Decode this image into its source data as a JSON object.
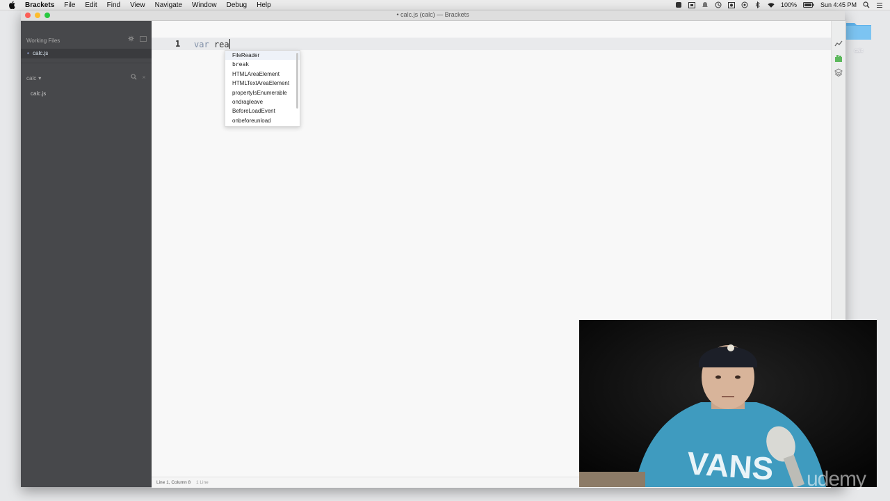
{
  "menubar": {
    "app_name": "Brackets",
    "items": [
      "File",
      "Edit",
      "Find",
      "View",
      "Navigate",
      "Window",
      "Debug",
      "Help"
    ],
    "battery": "100%",
    "clock": "Sun 4:45 PM"
  },
  "window": {
    "title": "• calc.js (calc) — Brackets"
  },
  "sidebar": {
    "working_files_label": "Working Files",
    "working_file": "calc.js",
    "project_name": "calc",
    "project_caret": "▾",
    "files": [
      "calc.js"
    ]
  },
  "editor": {
    "line_number": "1",
    "code_keyword": "var",
    "code_rest": " rea"
  },
  "code_hints": {
    "selected_index": 0,
    "items": [
      "FileReader",
      "break",
      "HTMLAreaElement",
      "HTMLTextAreaElement",
      "propertyIsEnumerable",
      "ondragleave",
      "BeforeLoadEvent",
      "onbeforeunload"
    ]
  },
  "statusbar": {
    "position": "Line 1, Column 8",
    "lines": "1 Line"
  },
  "desktop": {
    "folder_label": "calc"
  },
  "watermark": "udemy",
  "colors": {
    "sidebar_bg": "#47484b",
    "editor_bg": "#f8f8f8",
    "keyword": "#7f8ea6",
    "close_light": "#fc5f57",
    "min_light": "#fdbc2e",
    "max_light": "#28c840"
  }
}
